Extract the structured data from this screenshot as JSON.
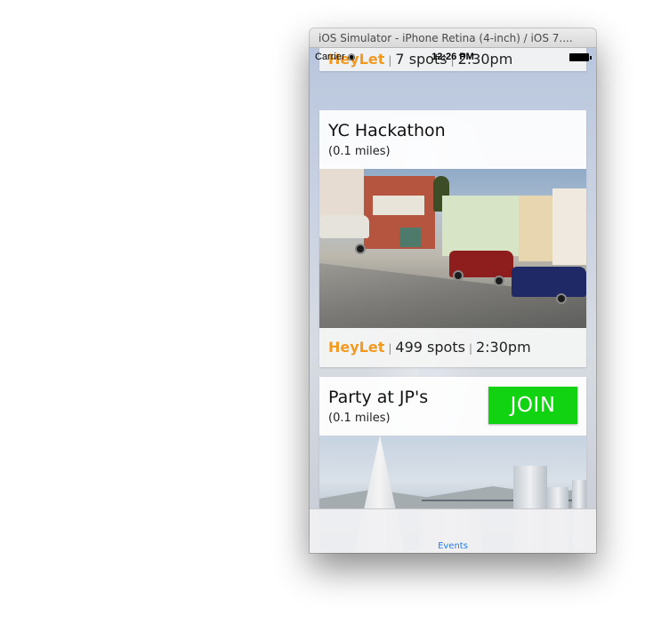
{
  "window": {
    "title": "iOS Simulator - iPhone Retina (4-inch) / iOS 7...."
  },
  "status_bar": {
    "carrier": "Carrier",
    "time": "12:26 PM"
  },
  "events": [
    {
      "brand": "HeyLet",
      "spots": "7 spots",
      "time": "2:30pm"
    },
    {
      "title": "YC Hackathon",
      "distance": "(0.1 miles)",
      "brand": "HeyLet",
      "spots": "499 spots",
      "time": "2:30pm"
    },
    {
      "title": "Party at JP's",
      "distance": "(0.1 miles)",
      "join_label": "JOIN"
    }
  ],
  "tab_bar": {
    "items": [
      {
        "label": "Events"
      }
    ]
  },
  "colors": {
    "brand": "#f39a1e",
    "join_button": "#12d312",
    "tab_active": "#1e7cf2"
  }
}
